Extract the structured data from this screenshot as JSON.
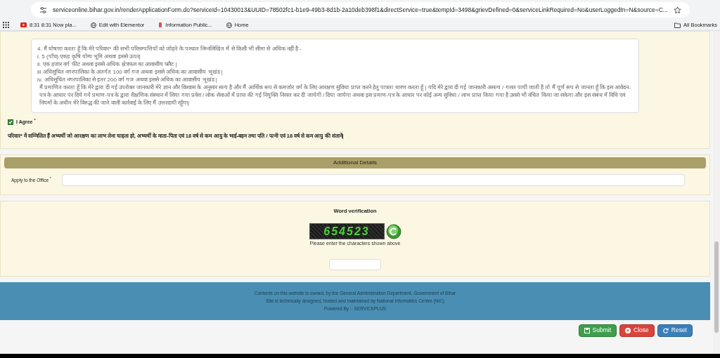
{
  "browser": {
    "url": "serviceonline.bihar.gov.in/renderApplicationForm.do?serviceId=10430013&UUID=78502fc1-b1e9-49b3-8d1b-2a10deb398f1&directService=true&tempId=3498&grievDefined=0&serviceLinkRequired=No&userLoggedIn=N&source=C...",
    "bookmarks": [
      {
        "label": "8:31 8:31 Now pla...",
        "kind": "video"
      },
      {
        "label": "Edit with Elementor",
        "kind": "globe"
      },
      {
        "label": "Information Public...",
        "kind": "emblem"
      },
      {
        "label": "Home",
        "kind": "globe"
      }
    ],
    "all_bookmarks": "All Bookmarks"
  },
  "declaration": {
    "lines": [
      "4. मैं घोषणा करता हूँ कि मेरे परिवार* की सभी परिसम्पत्तियों को जोड़ने के पश्चात निम्नलिखित में से किसी भी सीमा से अधिक नहीं है -",
      "i. 5 (पाँच) एकड़ कृषि योग्य भूमि अथवा इससे ऊपर|",
      "ii. एक हजार वर्ग फीट अथवा इससे अधिक क्षेत्रफल का आवासीय फ्लैट |",
      "iii.अधिसूचित नगरपालिका के अंतर्गत 100 वर्ग गज अथवा इससे अधिक का आवासीय भूखंड |",
      "iv. अधिसूचित नगरपालिका से इतर 200 वर्ग गज अथवा इससे अधिक का आवासीय भूखंड |",
      "मैं प्रमाणित करता हूँ कि मेरे द्वारा दी गई उपरोक्त जानकारी मेरे ज्ञान और विश्वास के अनुसार सत्य है  और मैं आर्थिक रूप से कमजोर वर्ग के लिए आरक्षण सुविधा प्राप्त करने हेतु पात्रता धारण करता हूँ |   यदि मेरे द्वारा दी गई जानकारी असत्य / गलत पायी जाती है तो मैं पूर्ण रूप से जानता हूँ   कि इस आवेदन-पत्र के आधार पर दिये गये प्रमाण-पत्र के द्वारा शैक्षणिक संस्थान में लिया गया प्रवेश / लोक सेवाओं में प्राप्त की गई नियुक्ति निरस्त कर दी जायेगी / दिया जायेगा अथवा इस प्रमाण-पत्र के आधार पर कोई अन्य सुविधा / लाभ प्राप्त किया गया है उससे भी वंचित किया जा सकेगा और इस संबंध में विधि एवं नियमों के अधीन मेरे विरुद्ध की जाने वाली कार्रवाई के लिए  मैं उत्तरदायी रहूँगा|"
    ],
    "agree": {
      "label": "I Agree",
      "required_mark": "*",
      "checked": true
    },
    "note": "परिवार* में सम्मिलित हैं अभ्यर्थी जो आरक्षण का लाभ लेना चाहता हो, अभ्यर्थी के माता-पिता एवं 18 वर्ष से कम आयु के भाई-बहन तथा पति / पत्नी एवं 18 वर्ष से कम आयु की संतानें|"
  },
  "additional_details": {
    "title": "Additional Details",
    "fields": [
      {
        "label": "Apply to the Office",
        "required_mark": "*"
      }
    ]
  },
  "verification": {
    "title": "Word verification",
    "captcha": "654523",
    "hint": "Please enter the characters shown above"
  },
  "footer": {
    "lines": [
      "Contents on this website is owned, by the General Administration Department, Government of Bihar",
      "Site is technically designed, hosted and maintained by National Informatics Centre (NIC)",
      "Powered By :- SERVICEPLUS"
    ]
  },
  "buttons": [
    {
      "label": "Submit",
      "kind": "submit"
    },
    {
      "label": "Close",
      "kind": "close"
    },
    {
      "label": "Reset",
      "kind": "reset"
    }
  ]
}
